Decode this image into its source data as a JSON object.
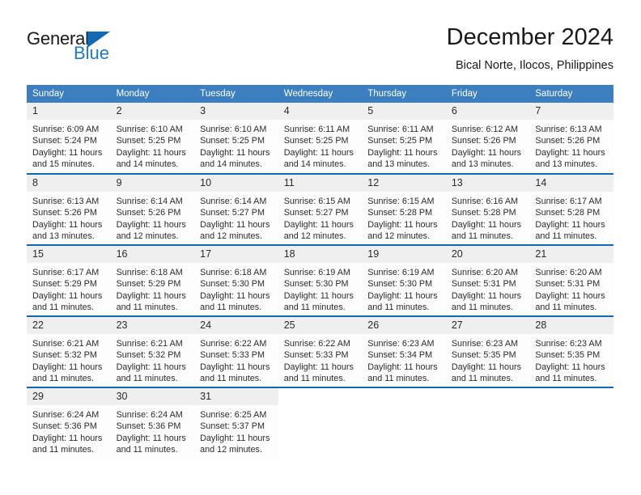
{
  "logo": {
    "word_one": "General",
    "word_two": "Blue",
    "triangle_color": "#1268b3",
    "blue_color": "#1f7ac4"
  },
  "header": {
    "title": "December 2024",
    "subtitle": "Bical Norte, Ilocos, Philippines"
  },
  "theme": {
    "header_bg": "#3c7fc1",
    "row_divider": "#1268b3",
    "daynum_bg": "#efefef"
  },
  "weekday_headers": [
    "Sunday",
    "Monday",
    "Tuesday",
    "Wednesday",
    "Thursday",
    "Friday",
    "Saturday"
  ],
  "weeks": [
    [
      {
        "day": "1",
        "sunrise": "Sunrise: 6:09 AM",
        "sunset": "Sunset: 5:24 PM",
        "daylight_1": "Daylight: 11 hours",
        "daylight_2": "and 15 minutes."
      },
      {
        "day": "2",
        "sunrise": "Sunrise: 6:10 AM",
        "sunset": "Sunset: 5:25 PM",
        "daylight_1": "Daylight: 11 hours",
        "daylight_2": "and 14 minutes."
      },
      {
        "day": "3",
        "sunrise": "Sunrise: 6:10 AM",
        "sunset": "Sunset: 5:25 PM",
        "daylight_1": "Daylight: 11 hours",
        "daylight_2": "and 14 minutes."
      },
      {
        "day": "4",
        "sunrise": "Sunrise: 6:11 AM",
        "sunset": "Sunset: 5:25 PM",
        "daylight_1": "Daylight: 11 hours",
        "daylight_2": "and 14 minutes."
      },
      {
        "day": "5",
        "sunrise": "Sunrise: 6:11 AM",
        "sunset": "Sunset: 5:25 PM",
        "daylight_1": "Daylight: 11 hours",
        "daylight_2": "and 13 minutes."
      },
      {
        "day": "6",
        "sunrise": "Sunrise: 6:12 AM",
        "sunset": "Sunset: 5:26 PM",
        "daylight_1": "Daylight: 11 hours",
        "daylight_2": "and 13 minutes."
      },
      {
        "day": "7",
        "sunrise": "Sunrise: 6:13 AM",
        "sunset": "Sunset: 5:26 PM",
        "daylight_1": "Daylight: 11 hours",
        "daylight_2": "and 13 minutes."
      }
    ],
    [
      {
        "day": "8",
        "sunrise": "Sunrise: 6:13 AM",
        "sunset": "Sunset: 5:26 PM",
        "daylight_1": "Daylight: 11 hours",
        "daylight_2": "and 13 minutes."
      },
      {
        "day": "9",
        "sunrise": "Sunrise: 6:14 AM",
        "sunset": "Sunset: 5:26 PM",
        "daylight_1": "Daylight: 11 hours",
        "daylight_2": "and 12 minutes."
      },
      {
        "day": "10",
        "sunrise": "Sunrise: 6:14 AM",
        "sunset": "Sunset: 5:27 PM",
        "daylight_1": "Daylight: 11 hours",
        "daylight_2": "and 12 minutes."
      },
      {
        "day": "11",
        "sunrise": "Sunrise: 6:15 AM",
        "sunset": "Sunset: 5:27 PM",
        "daylight_1": "Daylight: 11 hours",
        "daylight_2": "and 12 minutes."
      },
      {
        "day": "12",
        "sunrise": "Sunrise: 6:15 AM",
        "sunset": "Sunset: 5:28 PM",
        "daylight_1": "Daylight: 11 hours",
        "daylight_2": "and 12 minutes."
      },
      {
        "day": "13",
        "sunrise": "Sunrise: 6:16 AM",
        "sunset": "Sunset: 5:28 PM",
        "daylight_1": "Daylight: 11 hours",
        "daylight_2": "and 11 minutes."
      },
      {
        "day": "14",
        "sunrise": "Sunrise: 6:17 AM",
        "sunset": "Sunset: 5:28 PM",
        "daylight_1": "Daylight: 11 hours",
        "daylight_2": "and 11 minutes."
      }
    ],
    [
      {
        "day": "15",
        "sunrise": "Sunrise: 6:17 AM",
        "sunset": "Sunset: 5:29 PM",
        "daylight_1": "Daylight: 11 hours",
        "daylight_2": "and 11 minutes."
      },
      {
        "day": "16",
        "sunrise": "Sunrise: 6:18 AM",
        "sunset": "Sunset: 5:29 PM",
        "daylight_1": "Daylight: 11 hours",
        "daylight_2": "and 11 minutes."
      },
      {
        "day": "17",
        "sunrise": "Sunrise: 6:18 AM",
        "sunset": "Sunset: 5:30 PM",
        "daylight_1": "Daylight: 11 hours",
        "daylight_2": "and 11 minutes."
      },
      {
        "day": "18",
        "sunrise": "Sunrise: 6:19 AM",
        "sunset": "Sunset: 5:30 PM",
        "daylight_1": "Daylight: 11 hours",
        "daylight_2": "and 11 minutes."
      },
      {
        "day": "19",
        "sunrise": "Sunrise: 6:19 AM",
        "sunset": "Sunset: 5:30 PM",
        "daylight_1": "Daylight: 11 hours",
        "daylight_2": "and 11 minutes."
      },
      {
        "day": "20",
        "sunrise": "Sunrise: 6:20 AM",
        "sunset": "Sunset: 5:31 PM",
        "daylight_1": "Daylight: 11 hours",
        "daylight_2": "and 11 minutes."
      },
      {
        "day": "21",
        "sunrise": "Sunrise: 6:20 AM",
        "sunset": "Sunset: 5:31 PM",
        "daylight_1": "Daylight: 11 hours",
        "daylight_2": "and 11 minutes."
      }
    ],
    [
      {
        "day": "22",
        "sunrise": "Sunrise: 6:21 AM",
        "sunset": "Sunset: 5:32 PM",
        "daylight_1": "Daylight: 11 hours",
        "daylight_2": "and 11 minutes."
      },
      {
        "day": "23",
        "sunrise": "Sunrise: 6:21 AM",
        "sunset": "Sunset: 5:32 PM",
        "daylight_1": "Daylight: 11 hours",
        "daylight_2": "and 11 minutes."
      },
      {
        "day": "24",
        "sunrise": "Sunrise: 6:22 AM",
        "sunset": "Sunset: 5:33 PM",
        "daylight_1": "Daylight: 11 hours",
        "daylight_2": "and 11 minutes."
      },
      {
        "day": "25",
        "sunrise": "Sunrise: 6:22 AM",
        "sunset": "Sunset: 5:33 PM",
        "daylight_1": "Daylight: 11 hours",
        "daylight_2": "and 11 minutes."
      },
      {
        "day": "26",
        "sunrise": "Sunrise: 6:23 AM",
        "sunset": "Sunset: 5:34 PM",
        "daylight_1": "Daylight: 11 hours",
        "daylight_2": "and 11 minutes."
      },
      {
        "day": "27",
        "sunrise": "Sunrise: 6:23 AM",
        "sunset": "Sunset: 5:35 PM",
        "daylight_1": "Daylight: 11 hours",
        "daylight_2": "and 11 minutes."
      },
      {
        "day": "28",
        "sunrise": "Sunrise: 6:23 AM",
        "sunset": "Sunset: 5:35 PM",
        "daylight_1": "Daylight: 11 hours",
        "daylight_2": "and 11 minutes."
      }
    ],
    [
      {
        "day": "29",
        "sunrise": "Sunrise: 6:24 AM",
        "sunset": "Sunset: 5:36 PM",
        "daylight_1": "Daylight: 11 hours",
        "daylight_2": "and 11 minutes."
      },
      {
        "day": "30",
        "sunrise": "Sunrise: 6:24 AM",
        "sunset": "Sunset: 5:36 PM",
        "daylight_1": "Daylight: 11 hours",
        "daylight_2": "and 11 minutes."
      },
      {
        "day": "31",
        "sunrise": "Sunrise: 6:25 AM",
        "sunset": "Sunset: 5:37 PM",
        "daylight_1": "Daylight: 11 hours",
        "daylight_2": "and 12 minutes."
      },
      {
        "day": "",
        "sunrise": "",
        "sunset": "",
        "daylight_1": "",
        "daylight_2": ""
      },
      {
        "day": "",
        "sunrise": "",
        "sunset": "",
        "daylight_1": "",
        "daylight_2": ""
      },
      {
        "day": "",
        "sunrise": "",
        "sunset": "",
        "daylight_1": "",
        "daylight_2": ""
      },
      {
        "day": "",
        "sunrise": "",
        "sunset": "",
        "daylight_1": "",
        "daylight_2": ""
      }
    ]
  ]
}
